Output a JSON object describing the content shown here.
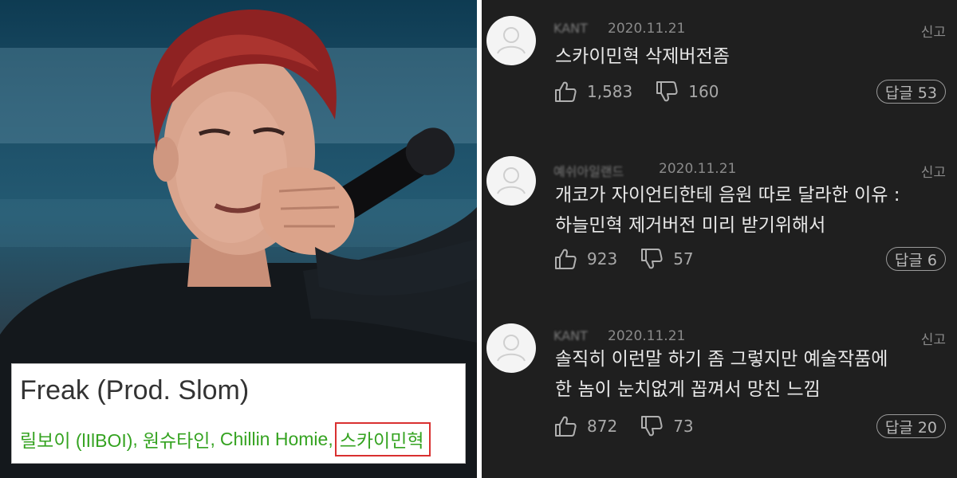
{
  "song": {
    "title": "Freak (Prod. Slom)",
    "artists": [
      {
        "name": "릴보이 (lIlBOI)",
        "highlighted": false
      },
      {
        "name": "원슈타인",
        "highlighted": false
      },
      {
        "name": "Chillin Homie",
        "highlighted": false
      },
      {
        "name": "스카이민혁",
        "highlighted": true
      }
    ],
    "separator": ","
  },
  "colors": {
    "artist_green": "#35a321",
    "highlight_red": "#d93030",
    "panel_bg": "#1f1f1f",
    "comment_text": "#e8e8e8",
    "meta_text": "#8a8a8a"
  },
  "comments": [
    {
      "author": "KANT",
      "date": "2020.11.21",
      "report_label": "신고",
      "lines": [
        "스카이민혁 삭제버전좀"
      ],
      "likes": "1,583",
      "dislikes": "160",
      "reply_label": "답글 53",
      "icons": {
        "avatar": "user-avatar-icon",
        "like": "thumbs-up-icon",
        "dislike": "thumbs-down-icon"
      }
    },
    {
      "author": "예쉬아일랜드",
      "date": "2020.11.21",
      "report_label": "신고",
      "lines": [
        "개코가 자이언티한테 음원 따로 달라한 이유 :",
        "하늘민혁 제거버전 미리 받기위해서"
      ],
      "likes": "923",
      "dislikes": "57",
      "reply_label": "답글 6",
      "icons": {
        "avatar": "user-avatar-icon",
        "like": "thumbs-up-icon",
        "dislike": "thumbs-down-icon"
      }
    },
    {
      "author": "KANT",
      "date": "2020.11.21",
      "report_label": "신고",
      "lines": [
        "솔직히 이런말 하기 좀 그렇지만 예술작품에",
        "한 놈이 눈치없게 꼽껴서 망친 느낌"
      ],
      "likes": "872",
      "dislikes": "73",
      "reply_label": "답글 20",
      "icons": {
        "avatar": "user-avatar-icon",
        "like": "thumbs-up-icon",
        "dislike": "thumbs-down-icon"
      }
    }
  ]
}
